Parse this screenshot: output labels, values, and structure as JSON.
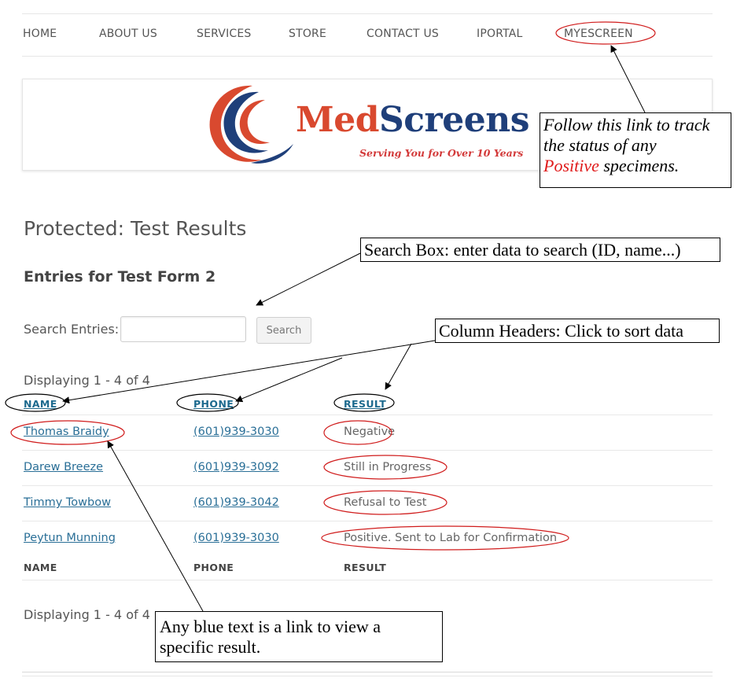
{
  "nav": {
    "items": [
      "HOME",
      "ABOUT US",
      "SERVICES",
      "STORE",
      "CONTACT US",
      "IPORTAL",
      "MYESCREEN"
    ]
  },
  "logo": {
    "med": "Med",
    "screens": "Screens",
    "tagline": "Serving You for Over 10 Years"
  },
  "annotations": {
    "myescreen_note": {
      "line1": "Follow this link to track",
      "line2": "the status of any",
      "positive_word": "Positive",
      "line3_rest": " specimens."
    },
    "search_note": "Search Box: enter data to search (ID, name...)",
    "headers_note": "Column Headers: Click to sort data",
    "links_note": {
      "line1": "Any blue text is a link to view a",
      "line2": "specific result."
    }
  },
  "page": {
    "title": "Protected: Test Results",
    "entries_title": "Entries for Test Form 2",
    "search_label": "Search Entries:",
    "search_placeholder": "",
    "search_button": "Search",
    "displaying_top": "Displaying 1 - 4 of 4",
    "displaying_bottom": "Displaying 1 - 4 of 4"
  },
  "table": {
    "headers": [
      "NAME",
      "PHONE",
      "RESULT"
    ],
    "rows": [
      {
        "name": "Thomas Braidy",
        "phone": "(601)939-3030",
        "result": "Negative"
      },
      {
        "name": "Darew Breeze",
        "phone": "(601)939-3092",
        "result": "Still in Progress"
      },
      {
        "name": "Timmy Towbow",
        "phone": "(601)939-3042",
        "result": "Refusal to Test"
      },
      {
        "name": "Peytun Munning",
        "phone": "(601)939-3030",
        "result": "Positive. Sent to Lab for Confirmation"
      }
    ],
    "footer_headers": [
      "NAME",
      "PHONE",
      "RESULT"
    ]
  },
  "colors": {
    "link": "#2a6f97",
    "annotation_ellipse": "#d01c1c",
    "logo_red": "#d9492f",
    "logo_blue": "#1f3f7a"
  }
}
